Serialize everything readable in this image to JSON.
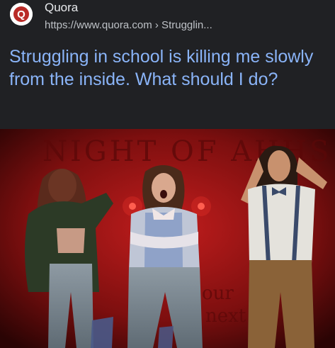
{
  "result": {
    "site_name": "Quora",
    "url": "https://www.quora.com › Strugglin...",
    "title": "Struggling in school is killing me slowly from the inside. What should I do?"
  },
  "favicon": {
    "icon": "quora-logo-icon",
    "letter": "Q",
    "color": "#b92b27"
  },
  "image": {
    "backdrop_text": [
      "NIGHT OF AHHS",
      "our",
      "next"
    ],
    "colors": {
      "backdrop": "#8e1414",
      "stage_light": "#ff3b30"
    }
  }
}
